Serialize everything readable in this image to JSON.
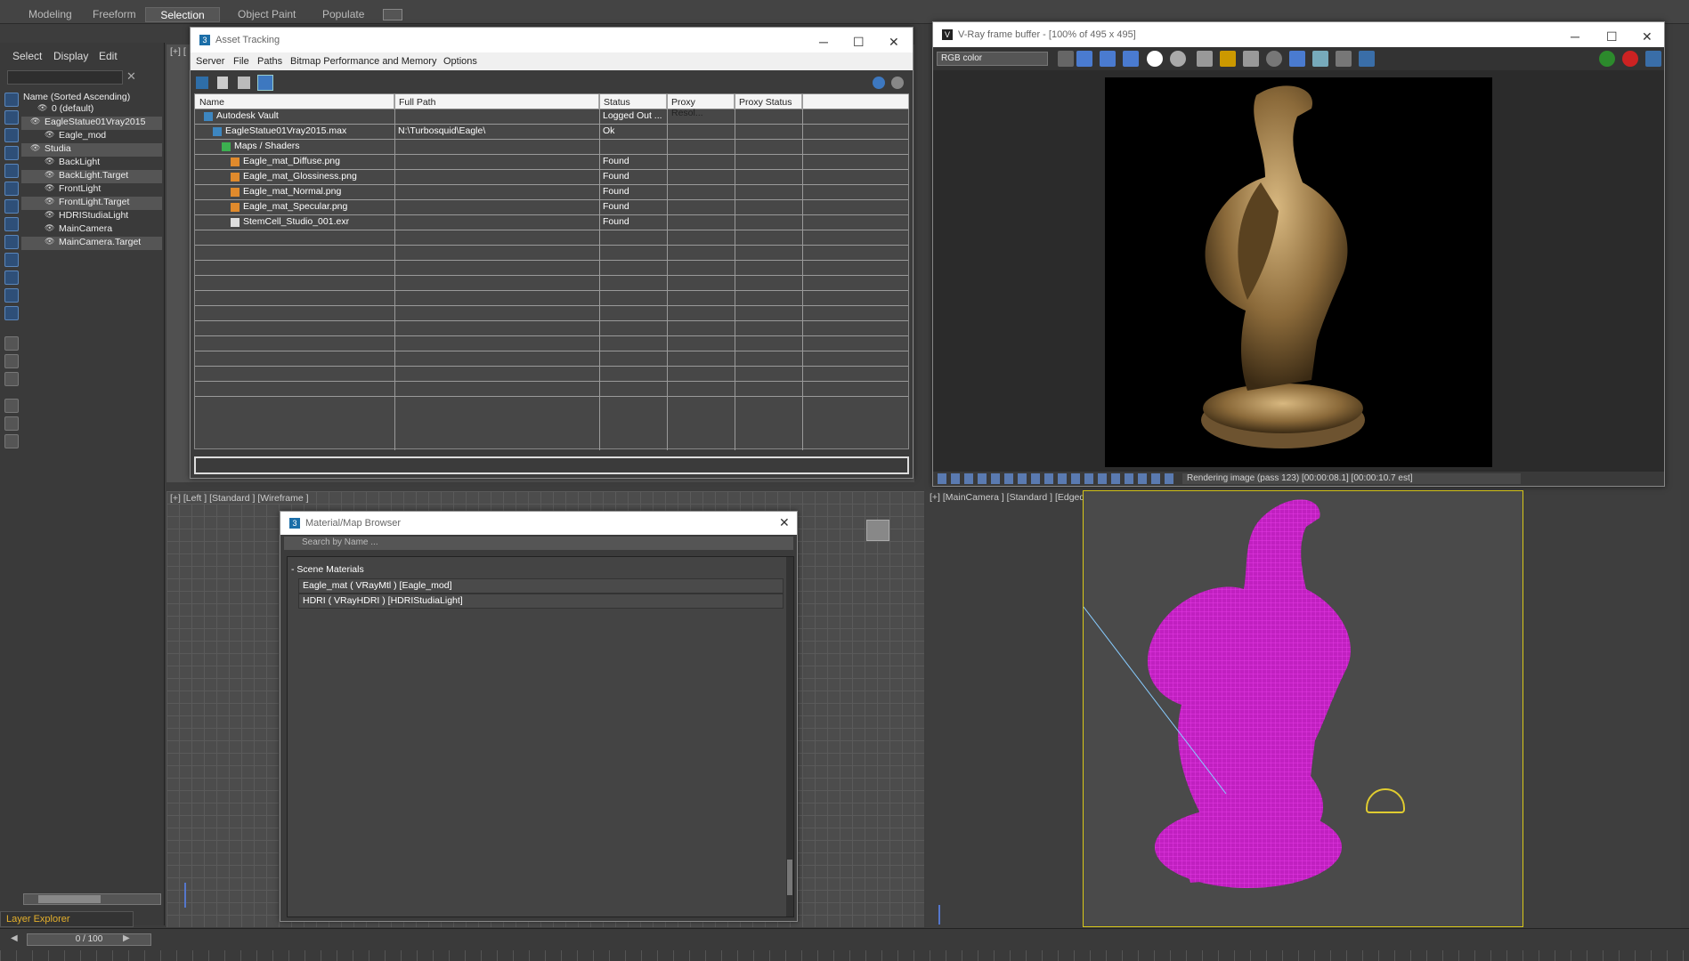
{
  "ribbon": {
    "tabs": [
      "Modeling",
      "Freeform",
      "Selection",
      "Object Paint",
      "Populate"
    ],
    "active": "Selection"
  },
  "scene_explorer": {
    "menu": [
      "Select",
      "Display",
      "Edit"
    ],
    "header": "Name (Sorted Ascending)",
    "items": [
      {
        "label": "0 (default)",
        "indent": 1
      },
      {
        "label": "EagleStatue01Vray2015",
        "indent": 0,
        "sel": true
      },
      {
        "label": "Eagle_mod",
        "indent": 2
      },
      {
        "label": "Studia",
        "indent": 0,
        "sel": true
      },
      {
        "label": "BackLight",
        "indent": 2
      },
      {
        "label": "BackLight.Target",
        "indent": 2,
        "sel": true
      },
      {
        "label": "FrontLight",
        "indent": 2
      },
      {
        "label": "FrontLight.Target",
        "indent": 2,
        "sel": true
      },
      {
        "label": "HDRIStudiaLight",
        "indent": 2
      },
      {
        "label": "MainCamera",
        "indent": 2
      },
      {
        "label": "MainCamera.Target",
        "indent": 2,
        "sel": true
      }
    ],
    "layer_explorer": "Layer Explorer",
    "timeline": "0 / 100"
  },
  "viewports": {
    "top_left": "[+] [",
    "bottom_left": "[+] [Left ] [Standard ] [Wireframe ]",
    "bottom_right": "[+] [MainCamera ] [Standard ] [Edged Faces ]"
  },
  "asset_tracking": {
    "title": "Asset Tracking",
    "menu": [
      "Server",
      "File",
      "Paths",
      "Bitmap Performance and Memory",
      "Options"
    ],
    "columns": [
      "Name",
      "Full Path",
      "Status",
      "Proxy Resol...",
      "Proxy Status"
    ],
    "rows": [
      {
        "name": "Autodesk Vault",
        "path": "",
        "status": "Logged Out ...",
        "indent": 1,
        "icon": "vault-icon"
      },
      {
        "name": "EagleStatue01Vray2015.max",
        "path": "N:\\Turbosquid\\Eagle\\",
        "status": "Ok",
        "indent": 2,
        "icon": "max-file-icon"
      },
      {
        "name": "Maps / Shaders",
        "path": "",
        "status": "",
        "indent": 3,
        "icon": "maps-icon"
      },
      {
        "name": "Eagle_mat_Diffuse.png",
        "path": "",
        "status": "Found",
        "indent": 4,
        "icon": "bitmap-icon"
      },
      {
        "name": "Eagle_mat_Glossiness.png",
        "path": "",
        "status": "Found",
        "indent": 4,
        "icon": "bitmap-icon"
      },
      {
        "name": "Eagle_mat_Normal.png",
        "path": "",
        "status": "Found",
        "indent": 4,
        "icon": "bitmap-icon"
      },
      {
        "name": "Eagle_mat_Specular.png",
        "path": "",
        "status": "Found",
        "indent": 4,
        "icon": "bitmap-icon"
      },
      {
        "name": "StemCell_Studio_001.exr",
        "path": "",
        "status": "Found",
        "indent": 4,
        "icon": "exr-file-icon"
      }
    ]
  },
  "vray": {
    "title": "V-Ray frame buffer - [100% of 495 x 495]",
    "channel": "RGB color",
    "status": "Rendering image (pass 123) [00:00:08.1] [00:00:10.7 est]"
  },
  "material_browser": {
    "title": "Material/Map Browser",
    "search_placeholder": "Search by Name ...",
    "section": "- Scene Materials",
    "items": [
      "Eagle_mat  ( VRayMtl ) [Eagle_mod]",
      "HDRI  ( VRayHDRI ) [HDRIStudiaLight]"
    ]
  }
}
